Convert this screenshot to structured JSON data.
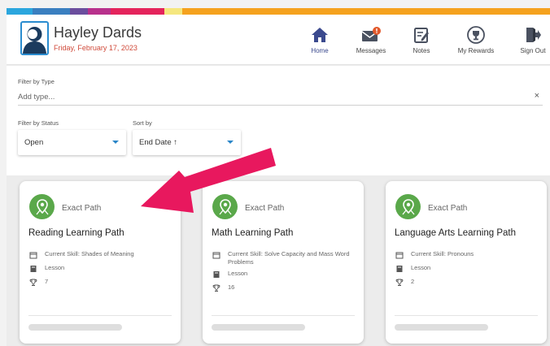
{
  "header": {
    "user_name": "Hayley Dards",
    "date": "Friday, February 17, 2023",
    "color_bar": [
      "#2ba6de",
      "#3a7fc0",
      "#6b4e9e",
      "#b8318c",
      "#e4245c",
      "#f5e77f",
      "#f5a21e"
    ],
    "nav": [
      {
        "label": "Home",
        "icon": "home-icon",
        "active": true
      },
      {
        "label": "Messages",
        "icon": "messages-icon",
        "active": false,
        "badge_color": "#e2582a"
      },
      {
        "label": "Notes",
        "icon": "notes-icon",
        "active": false
      },
      {
        "label": "My Rewards",
        "icon": "rewards-icon",
        "active": false
      },
      {
        "label": "Sign Out",
        "icon": "sign-out-icon",
        "active": false
      }
    ]
  },
  "filters": {
    "type_label": "Filter by Type",
    "type_placeholder": "Add type...",
    "status_label": "Filter by Status",
    "status_value": "Open",
    "sort_label": "Sort by",
    "sort_value": "End Date ↑"
  },
  "cards": [
    {
      "type": "Exact Path",
      "title": "Reading Learning Path",
      "skill": "Current Skill: Shades of Meaning",
      "activity": "Lesson",
      "trophies": "7",
      "progress": 0
    },
    {
      "type": "Exact Path",
      "title": "Math Learning Path",
      "skill": "Current Skill: Solve Capacity and Mass Word Problems",
      "activity": "Lesson",
      "trophies": "16",
      "progress": 0
    },
    {
      "type": "Exact Path",
      "title": "Language Arts Learning Path",
      "skill": "Current Skill: Pronouns",
      "activity": "Lesson",
      "trophies": "2",
      "progress": 0
    }
  ],
  "colors": {
    "accent_blue": "#2a86c8",
    "nav_active": "#3b4a8e",
    "path_green": "#5aa84a",
    "date_red": "#d04a3a",
    "annotation_arrow": "#e8185e"
  }
}
